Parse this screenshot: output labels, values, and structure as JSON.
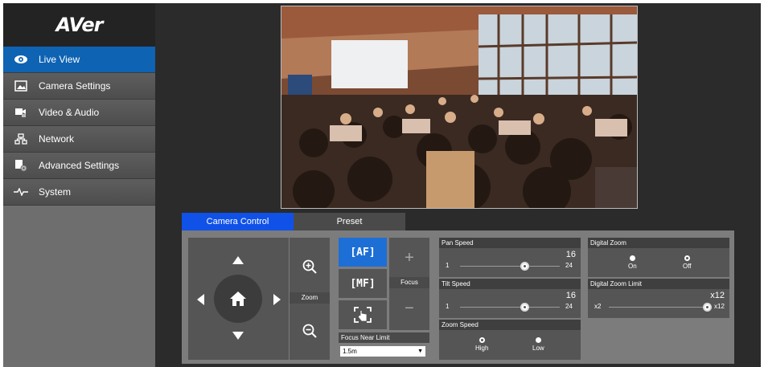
{
  "brand": {
    "logo_text": "AVer"
  },
  "sidebar": {
    "items": [
      {
        "label": "Live View",
        "icon": "eye-icon",
        "active": true
      },
      {
        "label": "Camera Settings",
        "icon": "image-icon",
        "active": false
      },
      {
        "label": "Video & Audio",
        "icon": "video-audio-icon",
        "active": false
      },
      {
        "label": "Network",
        "icon": "network-icon",
        "active": false
      },
      {
        "label": "Advanced Settings",
        "icon": "advanced-settings-icon",
        "active": false
      },
      {
        "label": "System",
        "icon": "pulse-icon",
        "active": false
      }
    ]
  },
  "tabs": [
    {
      "label": "Camera Control",
      "active": true
    },
    {
      "label": "Preset",
      "active": false
    }
  ],
  "ptz": {
    "zoom_label": "Zoom",
    "focus_label": "Focus",
    "af_label": "[AF]",
    "mf_label": "[MF]",
    "focus_plus": "+",
    "focus_minus": "−"
  },
  "focus_near_limit": {
    "label": "Focus Near Limit",
    "value": "1.5m"
  },
  "pan_speed": {
    "label": "Pan Speed",
    "value": "16",
    "min": "1",
    "max": "24",
    "fraction": 0.65
  },
  "tilt_speed": {
    "label": "Tilt Speed",
    "value": "16",
    "min": "1",
    "max": "24",
    "fraction": 0.65
  },
  "zoom_speed": {
    "label": "Zoom Speed",
    "options": [
      "High",
      "Low"
    ],
    "selected": "Low"
  },
  "digital_zoom": {
    "label": "Digital Zoom",
    "options": [
      "On",
      "Off"
    ],
    "selected": "On"
  },
  "digital_zoom_limit": {
    "label": "Digital Zoom Limit",
    "value": "x12",
    "min": "x2",
    "max": "x12",
    "fraction": 1.0
  },
  "colors": {
    "accent": "#0e63b3",
    "tab_active": "#1052e8",
    "af_active": "#1d6fd6"
  }
}
